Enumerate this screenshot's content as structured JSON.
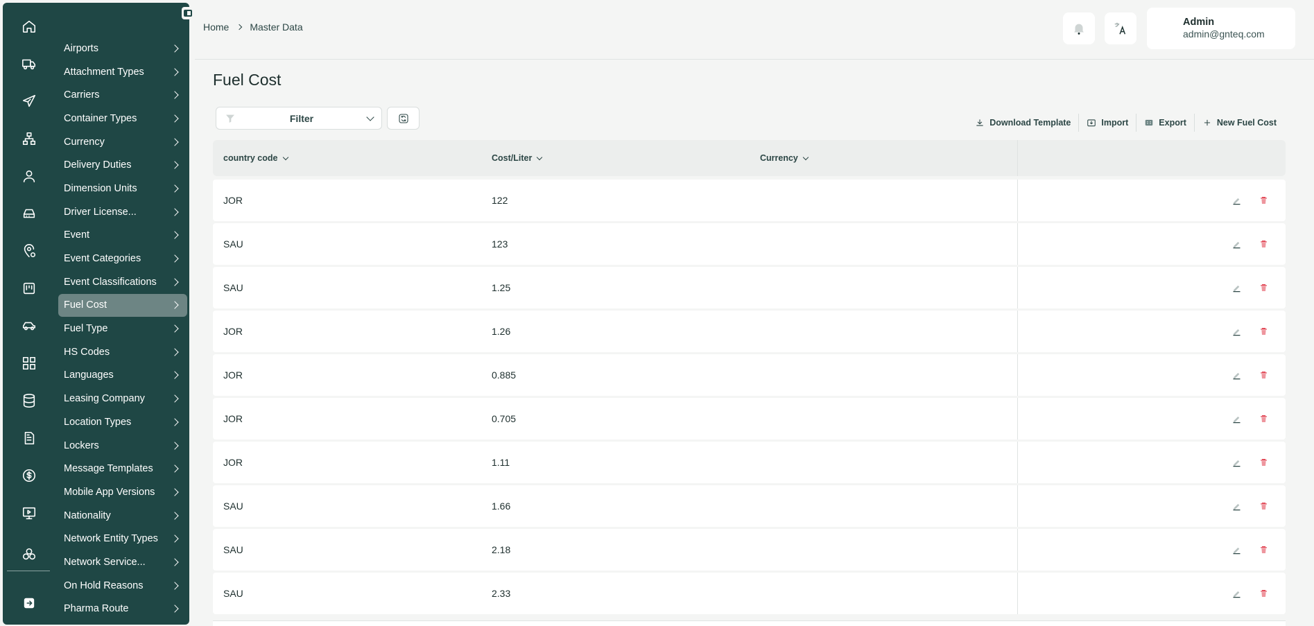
{
  "sidebar": {
    "rail_icons": [
      "home-icon",
      "truck-icon",
      "plane-icon",
      "org-chart-icon",
      "user-icon",
      "inbox-icon",
      "location-settings-icon",
      "kanban-icon",
      "car-icon",
      "dashboard-grid-icon",
      "database-icon",
      "document-list-icon",
      "dollar-icon",
      "presentation-icon",
      "network-nodes-icon",
      "logout-icon"
    ],
    "items": [
      {
        "label": "Airports"
      },
      {
        "label": "Attachment Types"
      },
      {
        "label": "Carriers"
      },
      {
        "label": "Container Types"
      },
      {
        "label": "Currency"
      },
      {
        "label": "Delivery Duties"
      },
      {
        "label": "Dimension Units"
      },
      {
        "label": "Driver License..."
      },
      {
        "label": "Event"
      },
      {
        "label": "Event Categories"
      },
      {
        "label": "Event Classifications"
      },
      {
        "label": "Fuel Cost",
        "active": true
      },
      {
        "label": "Fuel Type"
      },
      {
        "label": "HS Codes"
      },
      {
        "label": "Languages"
      },
      {
        "label": "Leasing Company"
      },
      {
        "label": "Location Types"
      },
      {
        "label": "Lockers"
      },
      {
        "label": "Message Templates"
      },
      {
        "label": "Mobile App Versions"
      },
      {
        "label": "Nationality"
      },
      {
        "label": "Network Entity Types"
      },
      {
        "label": "Network Service..."
      },
      {
        "label": "On Hold Reasons"
      },
      {
        "label": "Pharma Route"
      }
    ]
  },
  "header": {
    "breadcrumb": [
      "Home",
      "Master Data"
    ],
    "user": {
      "name": "Admin",
      "email": "admin@gnteq.com"
    }
  },
  "page": {
    "title": "Fuel Cost",
    "filter_label": "Filter"
  },
  "toolbar": {
    "download_template": "Download Template",
    "import": "Import",
    "export": "Export",
    "new": "New Fuel Cost"
  },
  "table": {
    "columns": [
      "country code",
      "Cost/Liter",
      "Currency"
    ],
    "rows": [
      {
        "country": "JOR",
        "cost": "122",
        "currency": ""
      },
      {
        "country": "SAU",
        "cost": "123",
        "currency": ""
      },
      {
        "country": "SAU",
        "cost": "1.25",
        "currency": ""
      },
      {
        "country": "JOR",
        "cost": "1.26",
        "currency": ""
      },
      {
        "country": "JOR",
        "cost": "0.885",
        "currency": ""
      },
      {
        "country": "JOR",
        "cost": "0.705",
        "currency": ""
      },
      {
        "country": "JOR",
        "cost": "1.11",
        "currency": ""
      },
      {
        "country": "SAU",
        "cost": "1.66",
        "currency": ""
      },
      {
        "country": "SAU",
        "cost": "2.18",
        "currency": ""
      },
      {
        "country": "SAU",
        "cost": "2.33",
        "currency": ""
      }
    ]
  },
  "colors": {
    "sidebar_bg": "#1f4745",
    "active_item": "#6d8584",
    "delete": "#e0404f"
  }
}
